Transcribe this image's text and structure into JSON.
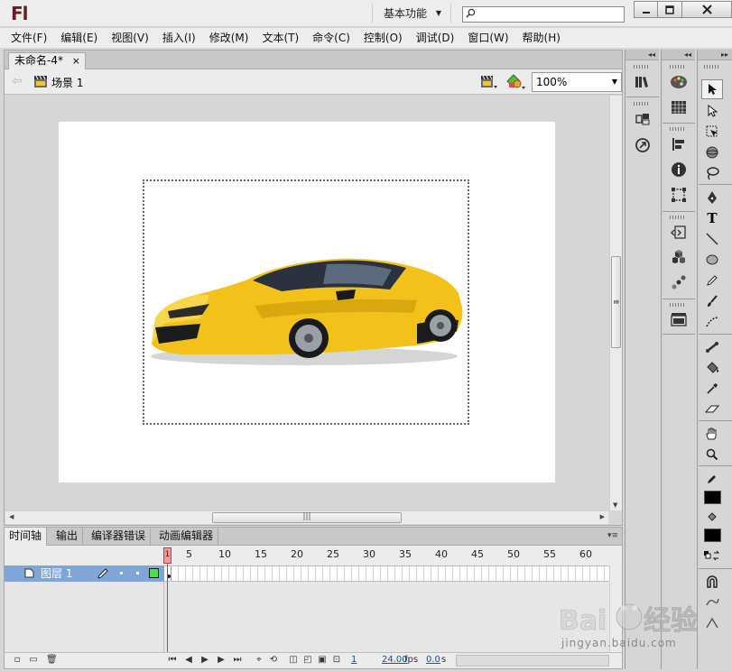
{
  "app": {
    "logo": "Fl",
    "workspace_label": "基本功能",
    "search_placeholder": ""
  },
  "window_controls": {
    "minimize_icon": "minimize-icon",
    "maximize_icon": "maximize-icon",
    "close_icon": "close-icon"
  },
  "menu": {
    "items": [
      {
        "label": "文件(F)"
      },
      {
        "label": "编辑(E)"
      },
      {
        "label": "视图(V)"
      },
      {
        "label": "插入(I)"
      },
      {
        "label": "修改(M)"
      },
      {
        "label": "文本(T)"
      },
      {
        "label": "命令(C)"
      },
      {
        "label": "控制(O)"
      },
      {
        "label": "调试(D)"
      },
      {
        "label": "窗口(W)"
      },
      {
        "label": "帮助(H)"
      }
    ]
  },
  "document": {
    "tab_title": "未命名-4*",
    "tab_close": "×",
    "scene_label": "场景 1",
    "zoom_value": "100%"
  },
  "timeline": {
    "tabs": [
      {
        "label": "时间轴"
      },
      {
        "label": "输出"
      },
      {
        "label": "编译器错误"
      },
      {
        "label": "动画编辑器"
      }
    ],
    "ruler_numbers": [
      "1",
      "5",
      "10",
      "15",
      "20",
      "25",
      "30",
      "35",
      "40",
      "45",
      "50",
      "55",
      "60"
    ],
    "layer_name": "图层 1",
    "current_frame": "1",
    "frame_rate": "24.00",
    "frame_rate_unit": "fps",
    "elapsed_time": "0.0",
    "elapsed_unit": "s"
  },
  "watermark": {
    "text": "jingyan.baidu.com"
  },
  "colors": {
    "layer_highlight": "#7fa5d9",
    "playhead": "#e03535",
    "layer_outline": "#4be04b",
    "logo": "#6a1f1f"
  }
}
